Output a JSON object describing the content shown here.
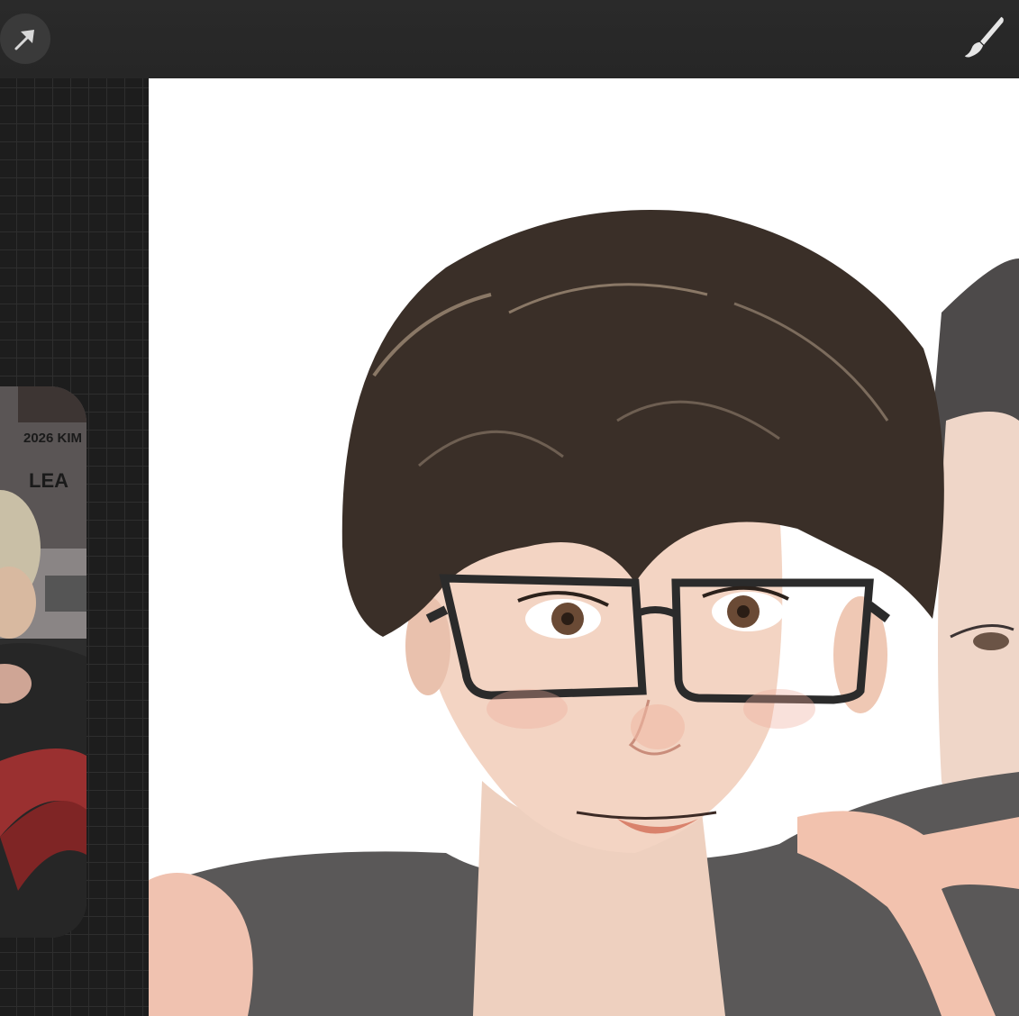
{
  "toolbar": {
    "left_icon": "transform-arrow-icon",
    "right_icon": "paintbrush-icon"
  },
  "reference": {
    "poster_text_1": "2026 KIM",
    "poster_text_2": "LEA"
  },
  "colors": {
    "toolbar_bg": "#2a2a2a",
    "canvas_bg": "#ffffff",
    "grid_bg": "#1d1d1d",
    "hair": "#3a2f28",
    "skin": "#f2d2c0",
    "glasses": "#2b2b2b",
    "shirt": "#5a5858"
  }
}
